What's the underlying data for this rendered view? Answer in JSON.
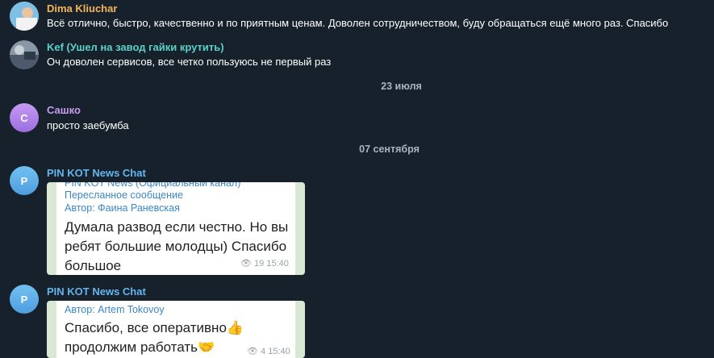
{
  "messages": [
    {
      "sender": "Dima Kliuchar",
      "text": "Всё отлично, быстро, качественно и по приятным ценам. Доволен сотрудничеством, буду обращаться ещё много раз. Спасибо"
    },
    {
      "sender": "Kef (Ушел на завод гайки крутить)",
      "text": "Оч доволен сервисов, все четко пользуюсь не первый раз"
    },
    {
      "sender": "Сашко",
      "avatar_letter": "С",
      "text": "просто заебумба"
    },
    {
      "sender": "PIN KOT News Chat",
      "avatar_letter": "P",
      "photo": {
        "top_cut": "PIN KOT News (Официальный канал)",
        "forwarded": "Пересланное сообщение",
        "author": "Автор: Фаина Раневская",
        "body": [
          "Думала развод если честно. Но вы",
          "ребят большие молодцы) Спасибо",
          "большое"
        ],
        "views": "19",
        "time": "15:40"
      }
    },
    {
      "sender": "PIN KOT News Chat",
      "avatar_letter": "P",
      "photo": {
        "author": "Автор: Artem Tokovoy",
        "body": [
          "Спасибо, все оперативно👍",
          "продолжим работать🤝"
        ],
        "views": "4",
        "time": "15:40"
      }
    }
  ],
  "dates": [
    "23 июля",
    "07 сентября"
  ],
  "colors": {
    "background": "#17212b",
    "dima": "#f4b55a",
    "kef": "#5bd0c9",
    "sashko": "#c89bf0",
    "pinkot": "#64b5ef"
  }
}
